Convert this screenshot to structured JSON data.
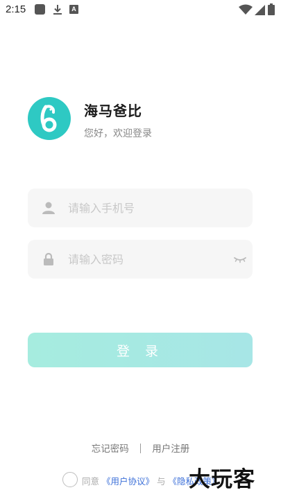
{
  "status_bar": {
    "time": "2:15",
    "letter_icon": "A",
    "icons": [
      "gallery-icon",
      "download-icon",
      "a-icon",
      "wifi-icon",
      "signal-icon",
      "battery-icon"
    ]
  },
  "header": {
    "app_name": "海马爸比",
    "welcome": "您好，欢迎登录",
    "logo_color": "#2ec9c3"
  },
  "form": {
    "phone_placeholder": "请输入手机号",
    "phone_value": "",
    "password_placeholder": "请输入密码",
    "password_value": "",
    "login_label": "登 录"
  },
  "links": {
    "forgot_password": "忘记密码",
    "register": "用户注册"
  },
  "agreement": {
    "prefix": "同意",
    "user_agreement": "《用户协议》",
    "conjunction": "与",
    "privacy_policy": "《隐私政策》"
  },
  "watermark": "大玩客",
  "colors": {
    "accent": "#2ec9c3",
    "button_gradient_start": "#a6ecdf",
    "button_gradient_end": "#a7e6e6",
    "link": "#3b6fd8"
  }
}
